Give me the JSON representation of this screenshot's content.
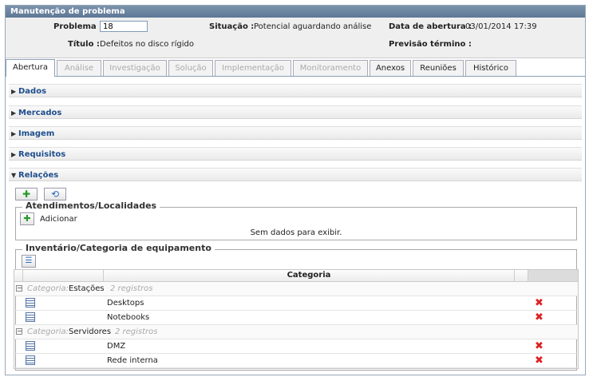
{
  "panel": {
    "title": "Manutenção de problema"
  },
  "header": {
    "problema_label": "Problema :",
    "problema_value": "18",
    "situacao_label": "Situação :",
    "situacao_value": "Potencial aguardando análise",
    "data_abertura_label": "Data de abertura :",
    "data_abertura_value": "03/01/2014 17:39",
    "titulo_label": "Título :",
    "titulo_value": "Defeitos no disco rígido",
    "previsao_label": "Previsão término :",
    "previsao_value": ""
  },
  "tabs": [
    {
      "label": "Abertura",
      "state": "active"
    },
    {
      "label": "Análise",
      "state": "disabled"
    },
    {
      "label": "Investigação",
      "state": "disabled"
    },
    {
      "label": "Solução",
      "state": "disabled"
    },
    {
      "label": "Implementação",
      "state": "disabled"
    },
    {
      "label": "Monitoramento",
      "state": "disabled"
    },
    {
      "label": "Anexos",
      "state": "enabled"
    },
    {
      "label": "Reuniões",
      "state": "enabled"
    },
    {
      "label": "Histórico",
      "state": "enabled"
    }
  ],
  "sections": [
    {
      "label": "Dados",
      "expanded": false
    },
    {
      "label": "Mercados",
      "expanded": false
    },
    {
      "label": "Imagem",
      "expanded": false
    },
    {
      "label": "Requisitos",
      "expanded": false
    },
    {
      "label": "Relações",
      "expanded": true
    }
  ],
  "atendimentos": {
    "legend": "Atendimentos/Localidades",
    "add_label": "Adicionar",
    "empty_text": "Sem dados para exibir."
  },
  "inventario": {
    "legend": "Inventário/Categoria de equipamento",
    "column_header": "Categoria",
    "group_prefix": "Categoria:",
    "groups": [
      {
        "name": "Estações",
        "count": "2 registros",
        "rows": [
          "Desktops",
          "Notebooks"
        ]
      },
      {
        "name": "Servidores",
        "count": "2 registros",
        "rows": [
          "DMZ",
          "Rede interna"
        ]
      }
    ]
  },
  "colors": {
    "title_bar": "#6a84a1",
    "section_text": "#1e4e8c",
    "delete": "#dd2222"
  }
}
